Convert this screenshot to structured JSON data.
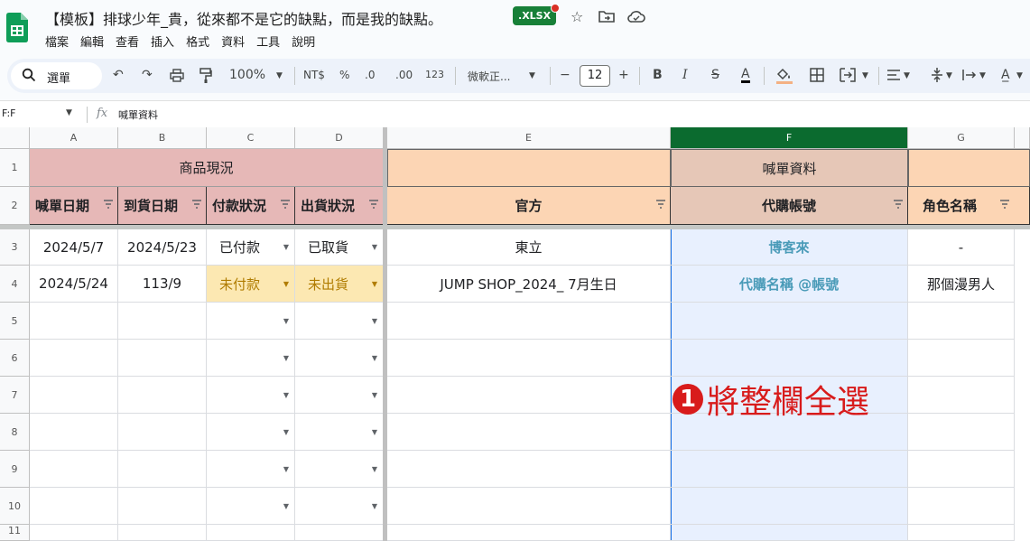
{
  "doc": {
    "title": "【模板】排球少年_貴，從來都不是它的缺點，而是我的缺點。",
    "badge": "XLSX"
  },
  "menu": [
    "檔案",
    "編輯",
    "查看",
    "插入",
    "格式",
    "資料",
    "工具",
    "說明"
  ],
  "toolbar": {
    "search": "選單",
    "zoom": "100%",
    "currency": "NT$",
    "percent": "%",
    "dec_less": ".0",
    "dec_more": ".00",
    "number_format": "123",
    "font": "微軟正...",
    "font_size": "12",
    "bold": "B",
    "italic": "I",
    "strike": "S",
    "text_color": "A"
  },
  "formula_bar": {
    "name_box": "F:F",
    "fx": "fx",
    "content": "喊單資料"
  },
  "columns": [
    "A",
    "B",
    "C",
    "D",
    "E",
    "F",
    "G"
  ],
  "rows": [
    "1",
    "2",
    "3",
    "4",
    "5",
    "6",
    "7",
    "8",
    "9",
    "10",
    "11"
  ],
  "sheet": {
    "row1": {
      "group_ad": "商品現況",
      "group_f": "喊單資料"
    },
    "headers": [
      "喊單日期",
      "到貨日期",
      "付款狀況",
      "出貨狀況",
      "官方",
      "代購帳號",
      "角色名稱"
    ],
    "data": [
      [
        "2024/5/7",
        "2024/5/23",
        "已付款",
        "已取貨",
        "東立",
        "博客來",
        "-"
      ],
      [
        "2024/5/24",
        "113/9",
        "未付款",
        "未出貨",
        "JUMP SHOP_2024_ 7月生日",
        "代購名稱 @帳號",
        "那個漫男人"
      ]
    ]
  },
  "annotation": {
    "number": "1",
    "text": "將整欄全選"
  },
  "colors": {
    "header_pink": "#e6b8b7",
    "header_peach": "#fcd5b4",
    "selected_col": "#0b6b2f",
    "selection_fill": "#e8f0fe",
    "link_blue": "#4a9bb8",
    "yellow": "#fce8b2",
    "annotation_red": "#d81b1b"
  }
}
